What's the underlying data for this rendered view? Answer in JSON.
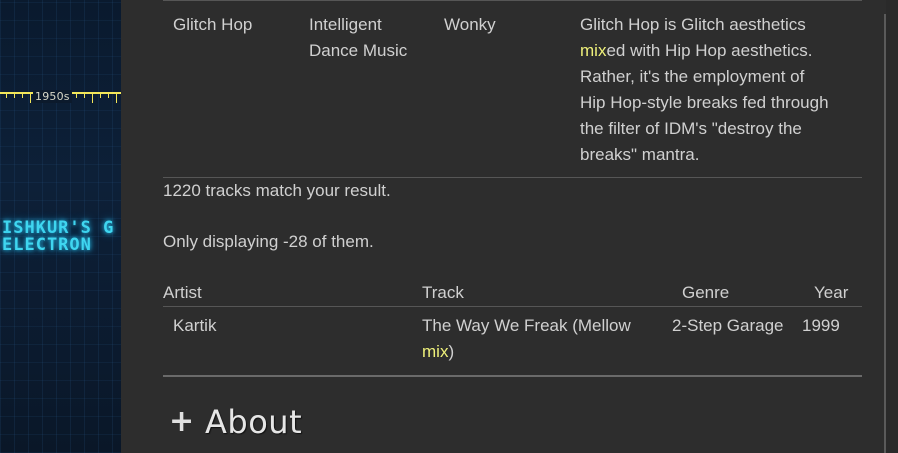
{
  "background": {
    "timeline_label": "1950s",
    "neon_text": "ISHKUR'S G\nELECTRON"
  },
  "genre_row": {
    "genre": "Glitch Hop",
    "parent": "Intelligent Dance Music",
    "alias": "Wonky",
    "description_before": "Glitch Hop is Glitch aesthetics ",
    "description_highlight": "mix",
    "description_after": "ed with Hip Hop aesthetics. Rather, it's the employment of Hip Hop-style breaks fed through the filter of IDM's \"destroy the breaks\" mantra."
  },
  "results": {
    "match_text": "1220 tracks match your result.",
    "display_text": "Only displaying -28 of them."
  },
  "tracks": {
    "headers": [
      "Artist",
      "Track",
      "Genre",
      "Year"
    ],
    "rows": [
      {
        "artist": "Kartik",
        "track_before": "The Way We Freak (Mellow ",
        "track_highlight": "mix",
        "track_after": ")",
        "genre": "2-Step Garage",
        "year": "1999"
      }
    ]
  },
  "about": {
    "icon": "plus-icon",
    "title": "About"
  },
  "colors": {
    "panel": "#2d2d2d",
    "highlight": "#eef07a",
    "neon": "#3fd6f0",
    "timeline": "#f2e65a"
  }
}
